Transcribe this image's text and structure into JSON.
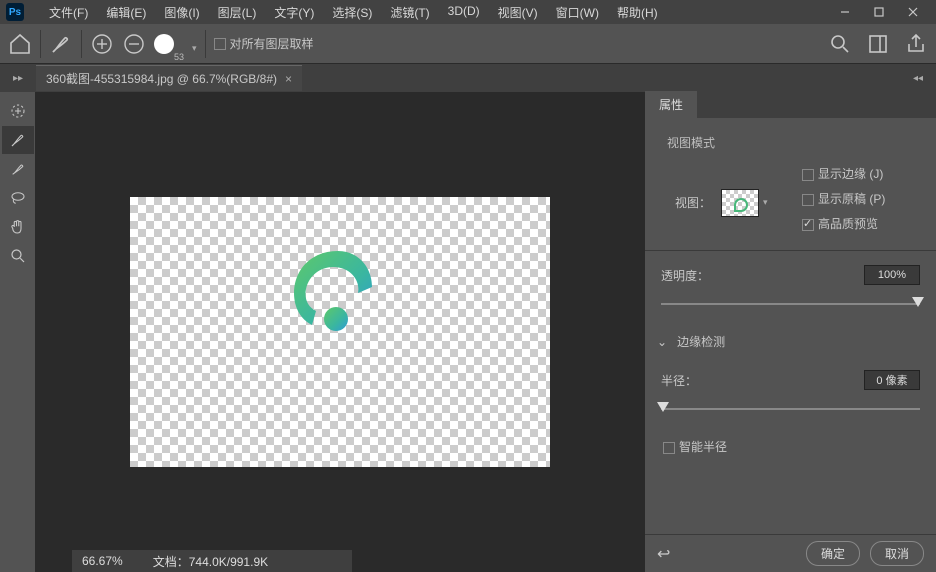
{
  "menu": {
    "file": "文件(F)",
    "edit": "编辑(E)",
    "image": "图像(I)",
    "layer": "图层(L)",
    "type": "文字(Y)",
    "select": "选择(S)",
    "filter": "滤镜(T)",
    "threeD": "3D(D)",
    "view": "视图(V)",
    "window": "窗口(W)",
    "help": "帮助(H)"
  },
  "options": {
    "sample_all": "对所有图层取样",
    "brush_size": "53"
  },
  "document": {
    "tab_label": "360截图-455315984.jpg @ 66.7%(RGB/8#)"
  },
  "status": {
    "zoom": "66.67%",
    "doc_label": "文档：",
    "doc_info": "744.0K/991.9K"
  },
  "panel": {
    "tab": "属性",
    "view_mode": "视图模式",
    "view_label": "视图：",
    "show_edge": "显示边缘 (J)",
    "show_original": "显示原稿 (P)",
    "hq_preview": "高品质预览",
    "opacity_label": "透明度：",
    "opacity_value": "100%",
    "edge_detect": "边缘检测",
    "radius_label": "半径：",
    "radius_value": "0 像素",
    "smart_radius": "智能半径",
    "ok": "确定",
    "cancel": "取消"
  }
}
